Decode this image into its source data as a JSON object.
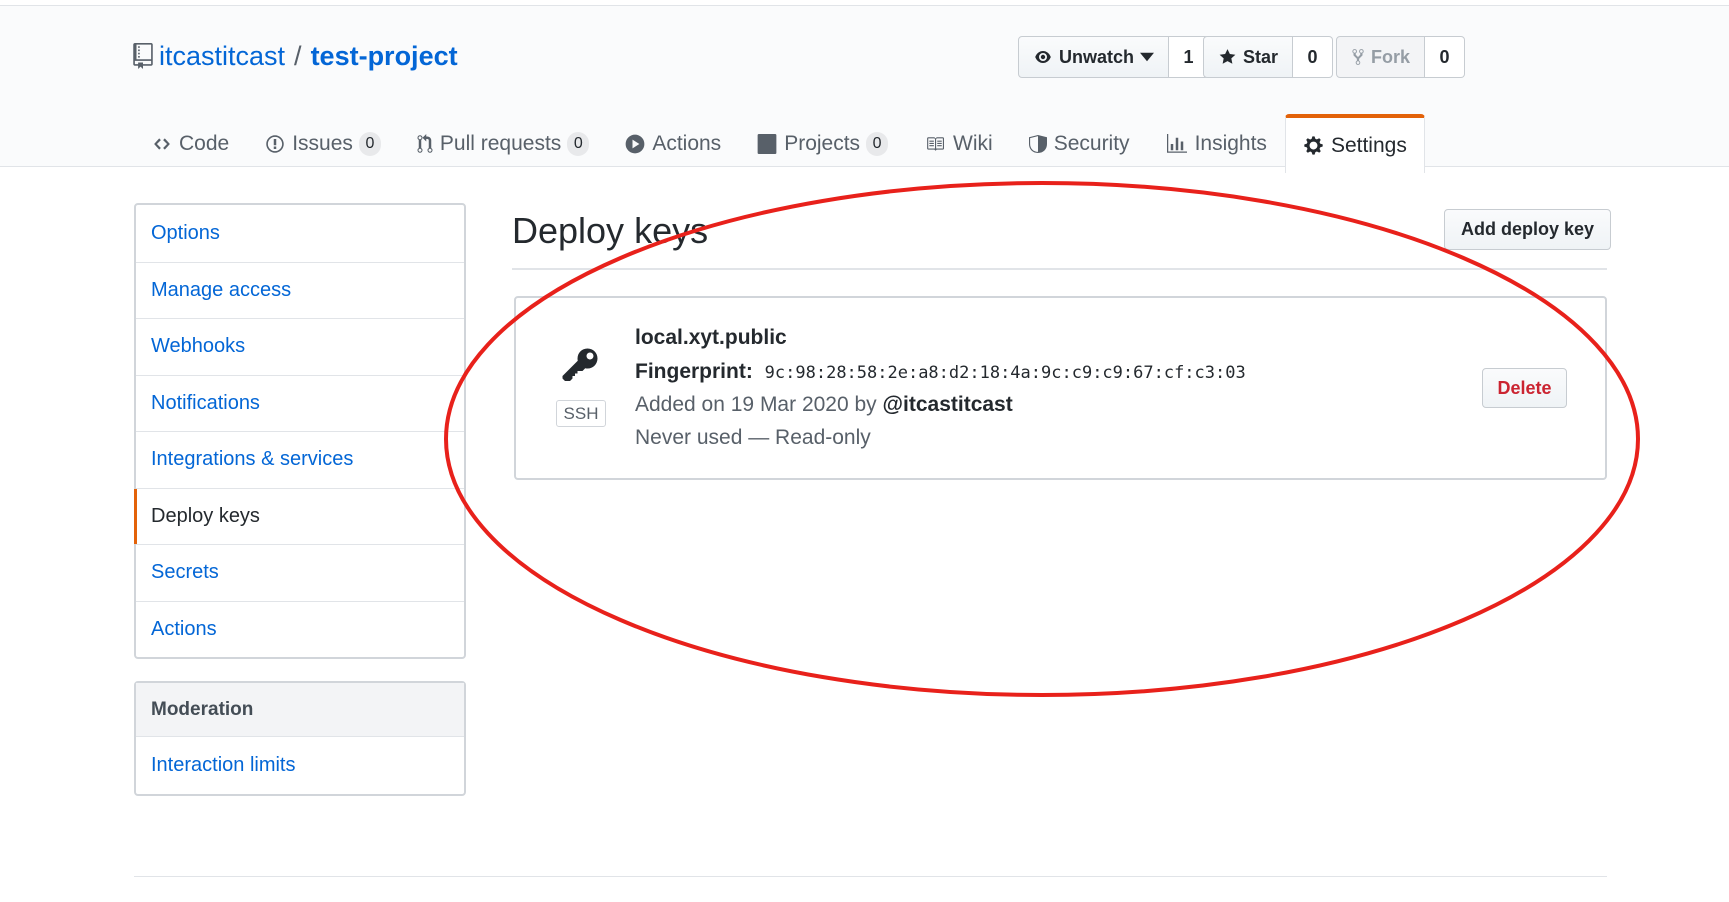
{
  "repo": {
    "owner": "itcastitcast",
    "separator": "/",
    "name": "test-project"
  },
  "header_actions": [
    {
      "label": "Unwatch",
      "count": "1",
      "icon": "eye-icon"
    },
    {
      "label": "Star",
      "count": "0",
      "icon": "star-icon"
    },
    {
      "label": "Fork",
      "count": "0",
      "icon": "fork-icon"
    }
  ],
  "tabs": [
    {
      "label": "Code",
      "icon": "code-icon"
    },
    {
      "label": "Issues",
      "count": "0",
      "icon": "issue-icon"
    },
    {
      "label": "Pull requests",
      "count": "0",
      "icon": "pull-request-icon"
    },
    {
      "label": "Actions",
      "icon": "play-icon"
    },
    {
      "label": "Projects",
      "count": "0",
      "icon": "project-icon"
    },
    {
      "label": "Wiki",
      "icon": "book-icon"
    },
    {
      "label": "Security",
      "icon": "shield-icon"
    },
    {
      "label": "Insights",
      "icon": "graph-icon"
    },
    {
      "label": "Settings",
      "icon": "gear-icon",
      "selected": true
    }
  ],
  "sidebar": {
    "items": [
      "Options",
      "Manage access",
      "Webhooks",
      "Notifications",
      "Integrations & services",
      "Deploy keys",
      "Secrets",
      "Actions"
    ],
    "selected": "Deploy keys",
    "moderation": {
      "heading": "Moderation",
      "items": [
        "Interaction limits"
      ]
    }
  },
  "main": {
    "title": "Deploy keys",
    "add_button": "Add deploy key",
    "key": {
      "type_label": "SSH",
      "title": "local.xyt.public",
      "fingerprint_label": "Fingerprint:",
      "fingerprint": "9c:98:28:58:2e:a8:d2:18:4a:9c:c9:c9:67:cf:c3:03",
      "added_prefix": "Added on 19 Mar 2020 by",
      "added_by": "@itcastitcast",
      "usage": "Never used — Read-only",
      "delete_label": "Delete"
    }
  },
  "colors": {
    "link": "#0366d6",
    "accent_tab": "#e36209",
    "danger": "#cb2431",
    "annotation": "#e8211b"
  }
}
